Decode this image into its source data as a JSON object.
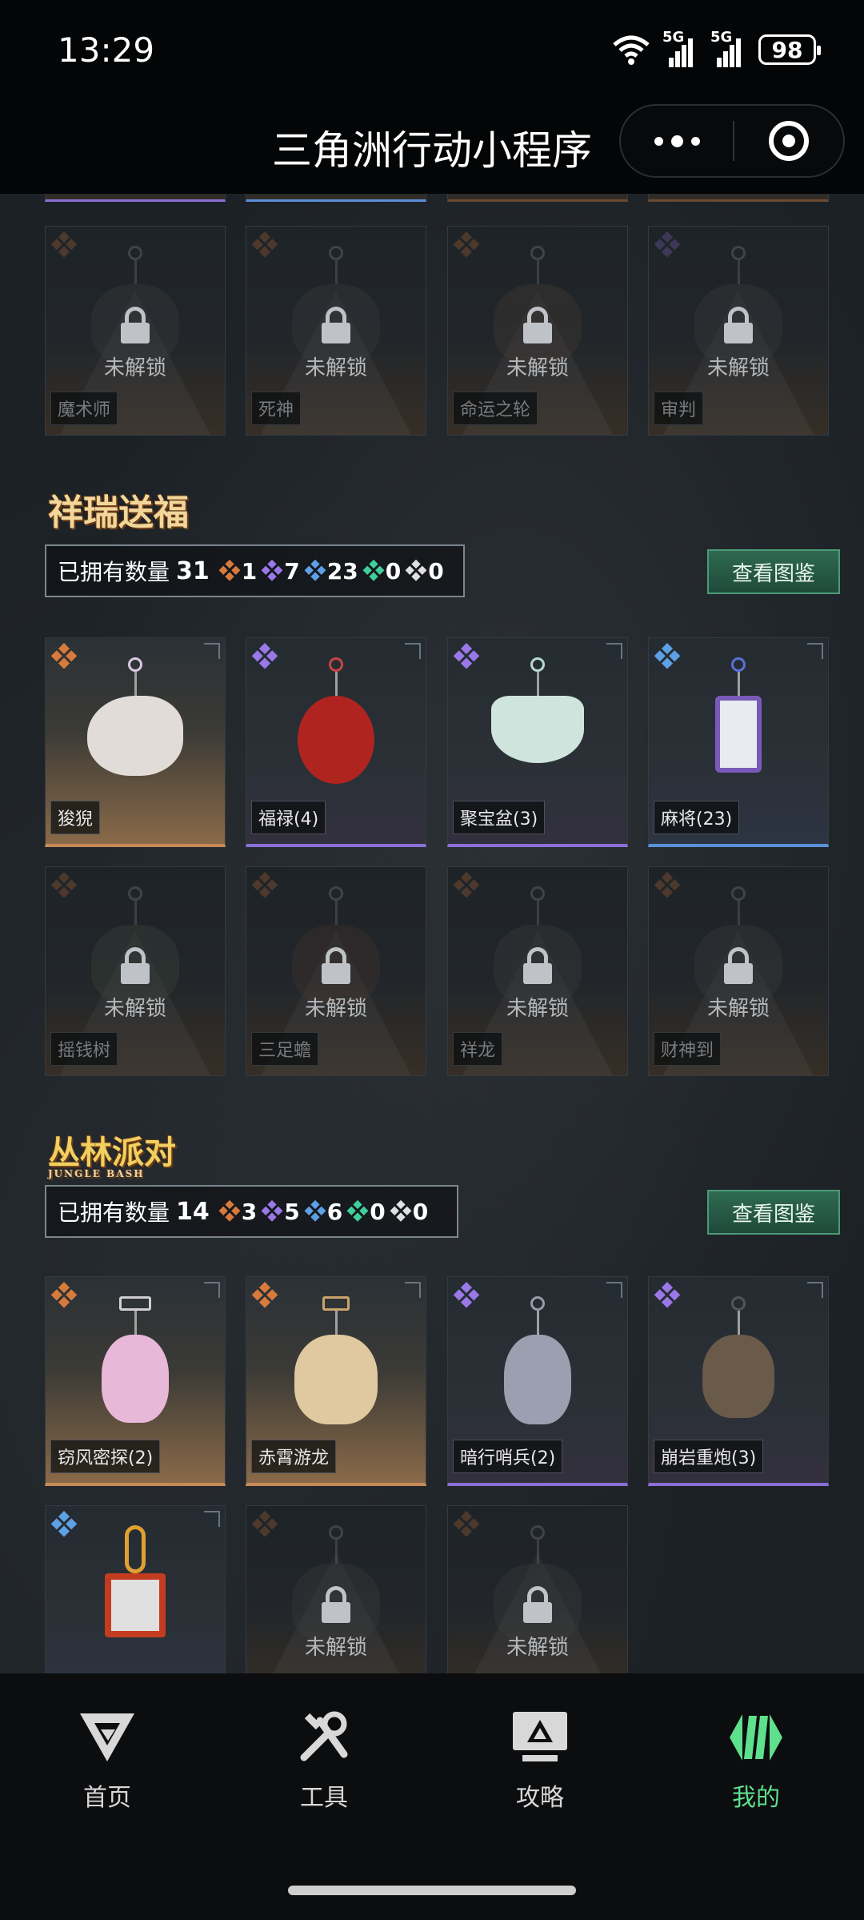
{
  "status": {
    "time": "13:29",
    "signal1": "5G",
    "signal2": "5G",
    "battery": "98"
  },
  "title": "三角洲行动小程序",
  "locked_label": "未解锁",
  "view_label": "查看图鉴",
  "owned_prefix": "已拥有数量",
  "top_row": [
    {
      "name": "魔术师"
    },
    {
      "name": "死神"
    },
    {
      "name": "命运之轮"
    },
    {
      "name": "审判"
    }
  ],
  "section1": {
    "logo": "祥瑞送福",
    "total": "31",
    "counts": [
      "1",
      "7",
      "23",
      "0",
      "0"
    ],
    "owned": [
      {
        "name": "狻猊",
        "rarity": "orange"
      },
      {
        "name": "福禄(4)",
        "rarity": "purple"
      },
      {
        "name": "聚宝盆(3)",
        "rarity": "purple"
      },
      {
        "name": "麻将(23)",
        "rarity": "blue"
      }
    ],
    "locked": [
      {
        "name": "摇钱树"
      },
      {
        "name": "三足蟾"
      },
      {
        "name": "祥龙"
      },
      {
        "name": "财神到"
      }
    ]
  },
  "section2": {
    "logo": "丛林派对",
    "logo_sub": "JUNGLE BASH",
    "total": "14",
    "counts": [
      "3",
      "5",
      "6",
      "0",
      "0"
    ],
    "owned": [
      {
        "name": "窃风密探(2)",
        "rarity": "orange"
      },
      {
        "name": "赤霄游龙",
        "rarity": "orange"
      },
      {
        "name": "暗行哨兵(2)",
        "rarity": "purple"
      },
      {
        "name": "崩岩重炮(3)",
        "rarity": "purple"
      }
    ]
  },
  "tabs": [
    {
      "label": "首页",
      "icon": "home-logo-icon"
    },
    {
      "label": "工具",
      "icon": "tools-icon"
    },
    {
      "label": "攻略",
      "icon": "guide-monitor-icon"
    },
    {
      "label": "我的",
      "icon": "profile-logo-icon",
      "active": true
    }
  ],
  "colors": {
    "accent_green": "#5ee08c",
    "orange": "#d87a3c",
    "purple": "#9a78e8",
    "blue": "#5ea0e6"
  }
}
